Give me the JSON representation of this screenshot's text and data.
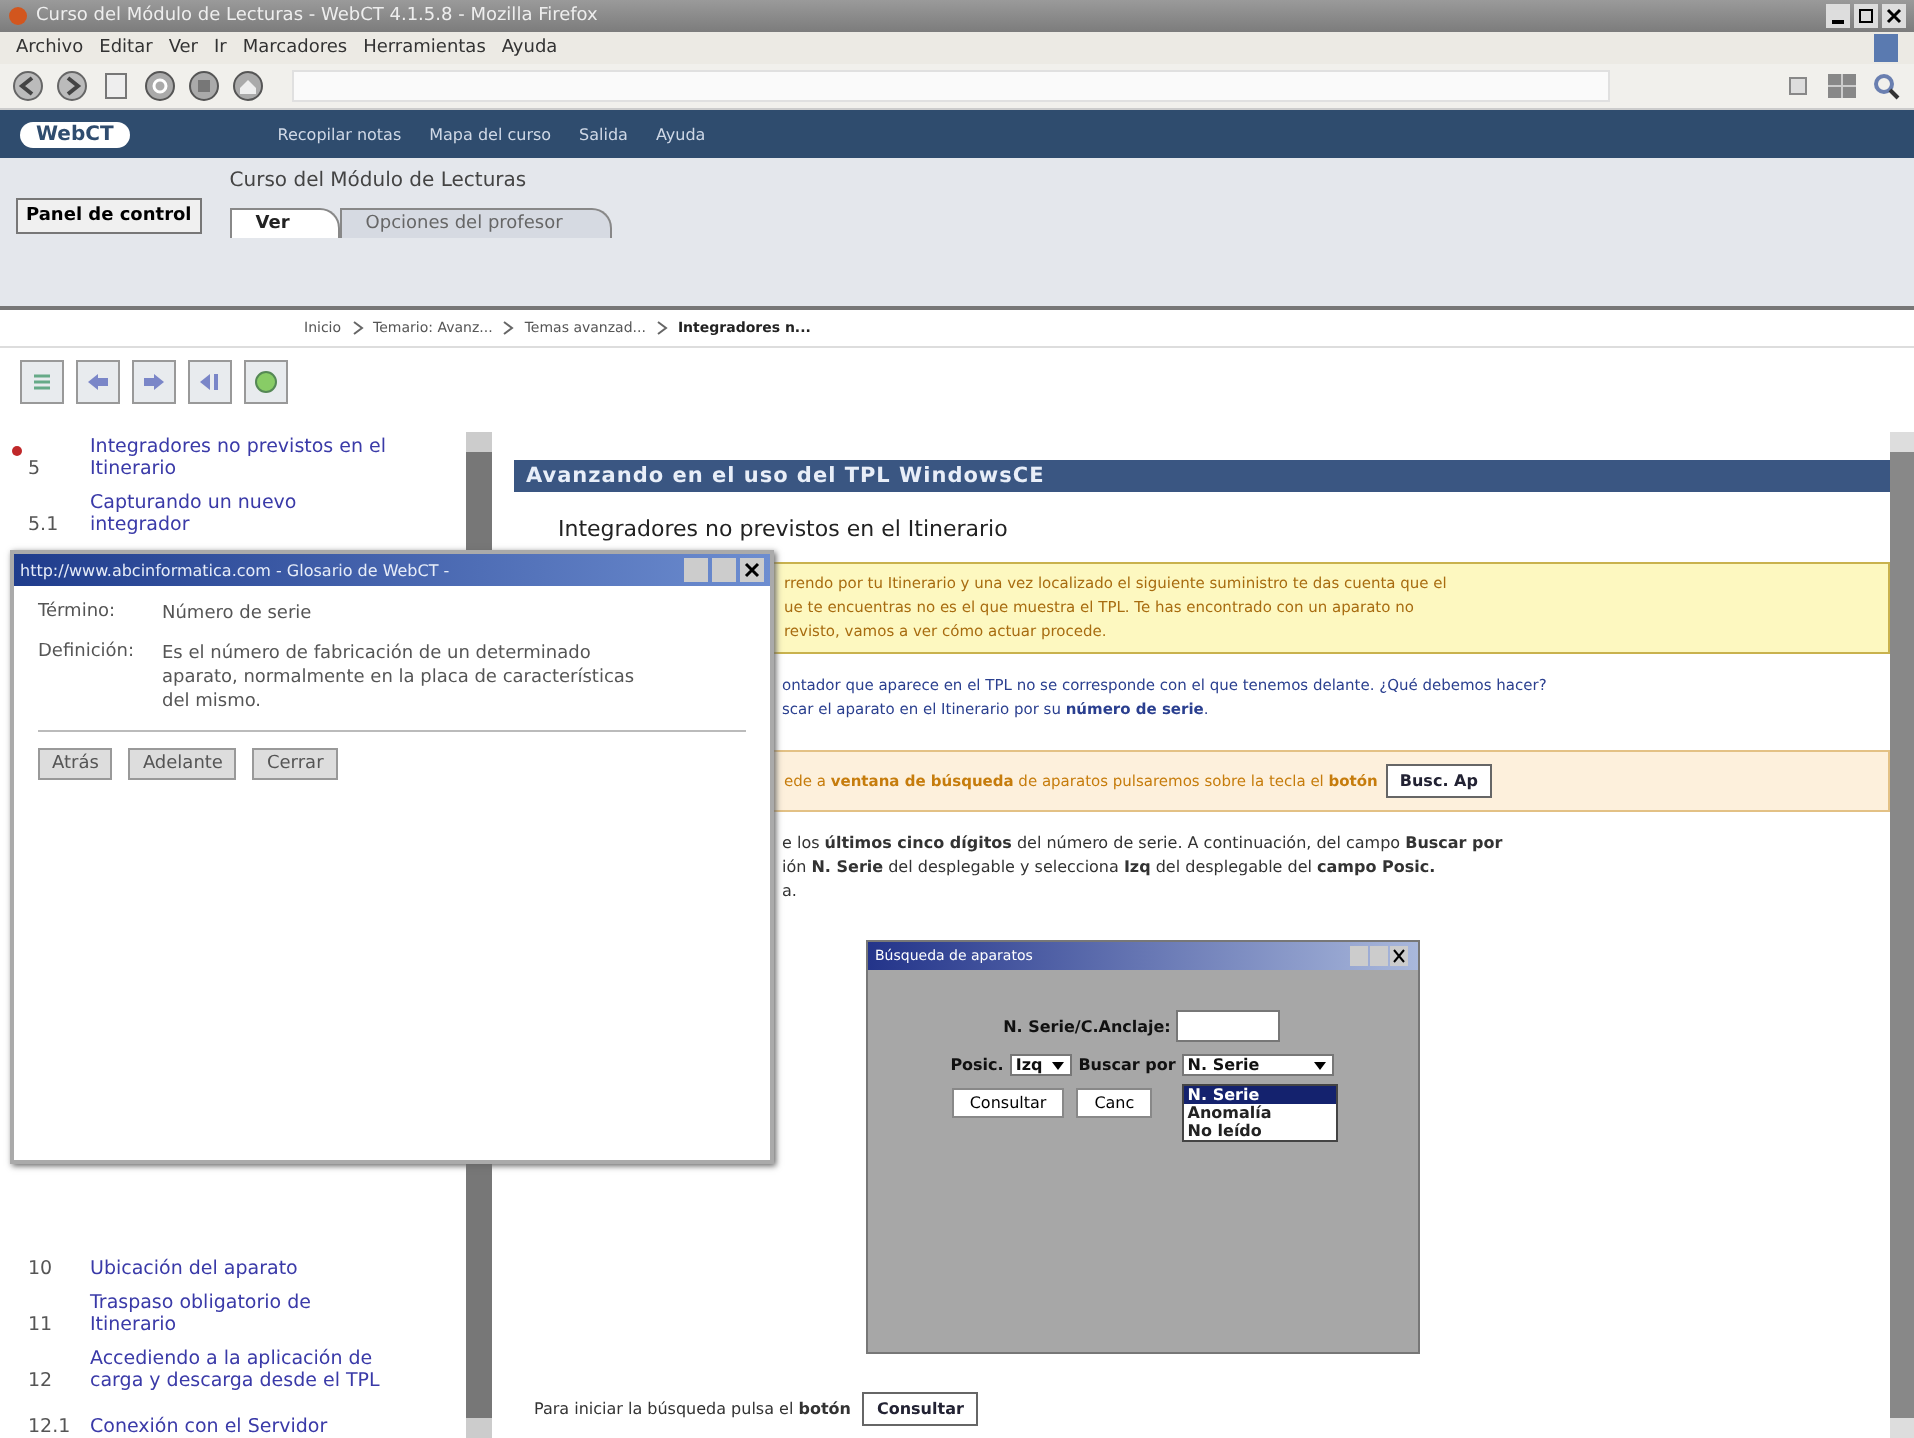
{
  "window": {
    "title": "Curso del Módulo de Lecturas - WebCT 4.1.5.8 - Mozilla Firefox"
  },
  "menu": [
    "Archivo",
    "Editar",
    "Ver",
    "Ir",
    "Marcadores",
    "Herramientas",
    "Ayuda"
  ],
  "webct": {
    "logo": "WebCT",
    "links": [
      "Recopilar notas",
      "Mapa del curso",
      "Salida",
      "Ayuda"
    ]
  },
  "course": {
    "panel_button": "Panel de control",
    "title": "Curso del Módulo de Lecturas",
    "tabs": [
      {
        "label": "Ver",
        "selected": true
      },
      {
        "label": "Opciones del profesor",
        "selected": false
      }
    ]
  },
  "breadcrumb": [
    {
      "label": "Inicio",
      "current": false
    },
    {
      "label": "Temario: Avanz...",
      "current": false
    },
    {
      "label": "Temas avanzad...",
      "current": false
    },
    {
      "label": "Integradores n...",
      "current": true
    }
  ],
  "toc_top": [
    {
      "number": "5",
      "label": "Integradores no previstos en el Itinerario",
      "current": true
    },
    {
      "number": "5.1",
      "label": "Capturando un nuevo integrador",
      "current": false
    }
  ],
  "toc_bottom": [
    {
      "number": "10",
      "label": "Ubicación del aparato",
      "current": false
    },
    {
      "number": "11",
      "label": "Traspaso obligatorio de Itinerario",
      "current": false
    },
    {
      "number": "12",
      "label": "Accediendo a la aplicación de carga y descarga desde el TPL",
      "current": false
    },
    {
      "number": "12.1",
      "label": "Conexión con el Servidor",
      "current": false
    }
  ],
  "content": {
    "heading": "Avanzando en el uso del TPL WindowsCE",
    "subheading": "Integradores no previstos en el Itinerario",
    "note_lines": [
      "rrendo por tu Itinerario y una vez localizado el siguiente suministro te das cuenta que el",
      "ue te encuentras no es el que muestra el TPL. Te has encontrado con un aparato no",
      "revisto, vamos a ver cómo actuar procede."
    ],
    "para1_lines": [
      "ontador que aparece en el TPL no se corresponde con el que tenemos delante. ¿Qué debemos hacer?",
      "scar el aparato en el Itinerario por su **número de serie**."
    ],
    "tip": "ede a **ventana de búsqueda** de aparatos pulsaremos sobre la tecla el **botón**",
    "tip_button": "Busc. Ap",
    "para2_lines": [
      "e los **últimos cinco dígitos** del número de serie. A continuación, del campo **Buscar por**",
      "ión **N. Serie** del desplegable y selecciona **Izq** del desplegable del **campo Posic.**",
      "a."
    ],
    "dialog": {
      "title": "Búsqueda de aparatos",
      "serial_label": "N. Serie/C.Anclaje:",
      "posic_label": "Posic.",
      "posic_value": "Izq",
      "search_label": "Buscar por",
      "search_value": "N. Serie",
      "options": [
        {
          "label": "N. Serie",
          "selected": true
        },
        {
          "label": "Anomalía",
          "selected": false
        },
        {
          "label": "No leído",
          "selected": false
        }
      ],
      "buttons": [
        "Consultar",
        "Canc"
      ]
    },
    "footer": "Para iniciar la búsqueda pulsa el **botón**",
    "footer_button": "Consultar"
  },
  "popup": {
    "title": "http://www.abcinformatica.com - Glosario de WebCT -",
    "term_label": "Término:",
    "term": "Número de serie",
    "definition_label": "Definición:",
    "definition": "Es el número de fabricación de un determinado aparato, normalmente en la placa de características del mismo.",
    "buttons": [
      "Atrás",
      "Adelante",
      "Cerrar"
    ]
  }
}
